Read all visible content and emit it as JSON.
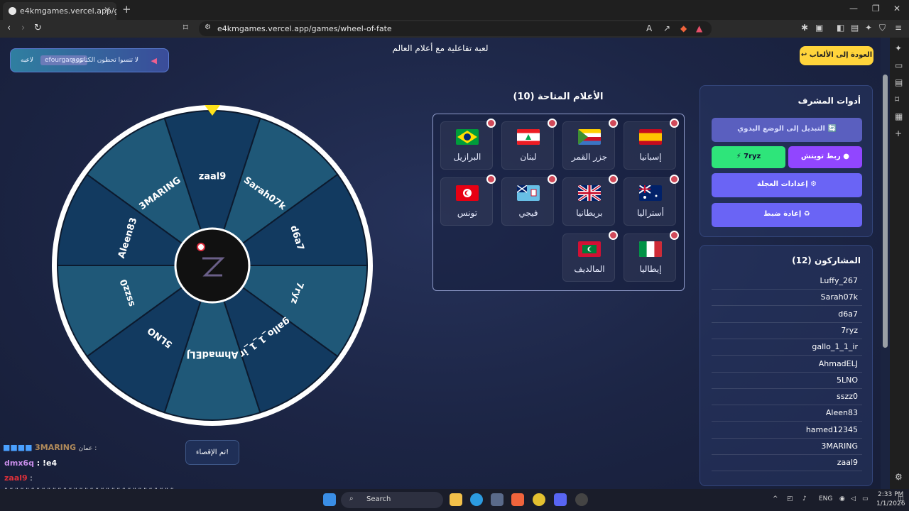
{
  "browser": {
    "tab_title": "e4kmgames.vercel.app/games/w",
    "url": "e4kmgames.vercel.app/games/wheel-of-fate"
  },
  "promo": {
    "text": "لا تنسوا تحطون الكتاتوري",
    "chip": "efourgames",
    "suffix": "لاعبه"
  },
  "page_title": "لعبة تفاعلية مع أعلام العالم",
  "back_button": "↩ العودة إلى الألعاب",
  "wheel": {
    "segments": [
      "zaal9",
      "Sarah07k",
      "d6a7",
      "7ryz",
      "gallo_1_1_ir",
      "AhmadELJ",
      "5LNO",
      "sszz0",
      "Aleen83",
      "3MARING"
    ],
    "colors": [
      "#123a60",
      "#1f5878"
    ]
  },
  "done_button": "تم الإقصاء!",
  "flags": {
    "title": "الأعلام المتاحة (10)",
    "items": [
      {
        "name": "إسبانيا",
        "code": "es"
      },
      {
        "name": "جزر القمر",
        "code": "km"
      },
      {
        "name": "لبنان",
        "code": "lb"
      },
      {
        "name": "البرازيل",
        "code": "br"
      },
      {
        "name": "أستراليا",
        "code": "au"
      },
      {
        "name": "بريطانيا",
        "code": "gb"
      },
      {
        "name": "فيجي",
        "code": "fj"
      },
      {
        "name": "تونس",
        "code": "tn"
      },
      {
        "name": "إيطاليا",
        "code": "it"
      },
      {
        "name": "المالديف",
        "code": "mv"
      }
    ]
  },
  "admin": {
    "title": "أدوات المشرف",
    "manual_mode": "التبديل إلى الوضع اليدوي 🔄",
    "twitch_link": "ربط تويتش",
    "twitch_user": "7ryz",
    "wheel_settings": "إعدادات العجلة ⚙",
    "reset": "إعادة ضبط ♻"
  },
  "participants": {
    "title": "المشاركون (12)",
    "names": [
      "Luffy_267",
      "Sarah07k",
      "d6a7",
      "7ryz",
      "gallo_1_1_ir",
      "AhmadELJ",
      "5LNO",
      "sszz0",
      "Aleen83",
      "hamed12345",
      "3MARING",
      "zaal9"
    ]
  },
  "chat": {
    "lines": [
      {
        "user": "3MARING",
        "prefix": "عمان :",
        "text": "",
        "color": "#b08a5a"
      },
      {
        "user": "dmx6q",
        "text": "!e4",
        "color": "#c58be6"
      },
      {
        "user": "zaal9",
        "text": "",
        "color": "#e0303a"
      }
    ],
    "spam1": "################################",
    "spam2": "####################"
  },
  "taskbar": {
    "search": "Search",
    "lang": "ENG",
    "time": "2:33 PM",
    "date": "1/1/2026"
  }
}
